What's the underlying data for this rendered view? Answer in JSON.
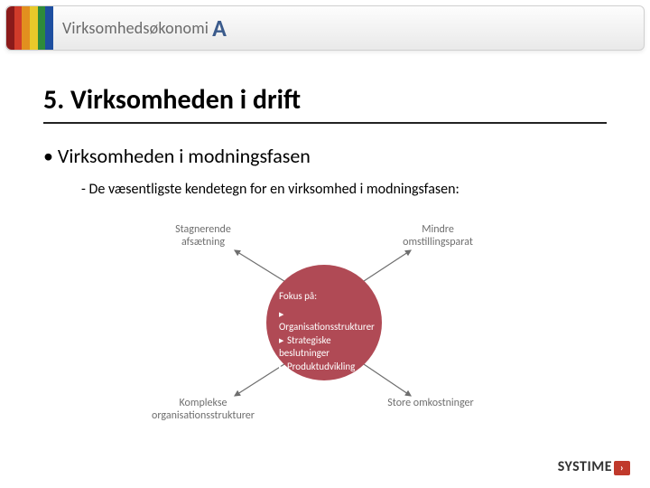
{
  "header": {
    "brand_text": "Virksomhedsøkonomi",
    "brand_letter": "A"
  },
  "content": {
    "heading": "5. Virksomheden i drift",
    "bullet": "• Virksomheden i modningsfasen",
    "subline": "- De væsentligste kendetegn for en virksomhed i modningsfasen:"
  },
  "diagram": {
    "top_left": "Stagnerende\nafsætning",
    "top_right": "Mindre\nomstillingsparat",
    "bottom_left": "Komplekse\norganisationsstrukturer",
    "bottom_right": "Store omkostninger",
    "circle_title": "Fokus på:",
    "circle_items": [
      "Organisationsstrukturer",
      "Strategiske beslutninger",
      "Produktudvikling"
    ]
  },
  "footer": {
    "logo_text": "SYSTIME",
    "arrow_glyph": "›"
  }
}
